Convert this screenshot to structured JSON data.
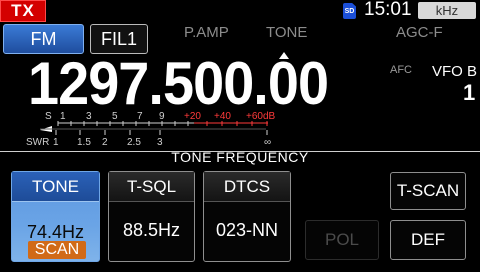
{
  "status_bar": {
    "tx_label": "TX",
    "sd_label": "SD",
    "time": "15:01",
    "unit_label": "kHz"
  },
  "mode_row": {
    "mode": "FM",
    "filter": "FIL1",
    "preamp_label": "P.AMP",
    "tone_label": "TONE",
    "agc_label": "AGC-F"
  },
  "display": {
    "frequency": "1297.500.00",
    "afc_label": "AFC",
    "vfo_label": "VFO B",
    "vfo_number": "1"
  },
  "meter": {
    "s_label": "S",
    "s_scale": [
      "1",
      "3",
      "5",
      "7",
      "9"
    ],
    "over_scale": [
      "+20",
      "+40",
      "+60dB"
    ],
    "swr_label": "SWR",
    "swr_scale": [
      "1",
      "1.5",
      "2",
      "2.5",
      "3",
      "∞"
    ],
    "colors": {
      "normal": "#cfcfcf",
      "over": "#ff3a3a"
    }
  },
  "tone_panel": {
    "title": "TONE FREQUENCY",
    "tone": {
      "label": "TONE",
      "value": "74.4Hz",
      "scan_tag": "SCAN"
    },
    "tsql": {
      "label": "T-SQL",
      "value": "88.5Hz"
    },
    "dtcs": {
      "label": "DTCS",
      "value": "023-NN"
    },
    "tscan_label": "T-SCAN",
    "pol_label": "POL",
    "def_label": "DEF"
  },
  "colors": {
    "accent_blue": "#3b7bd6",
    "tx_red": "#d40000",
    "scan_orange": "#d16a17",
    "dim_text": "#8c8c8c"
  }
}
